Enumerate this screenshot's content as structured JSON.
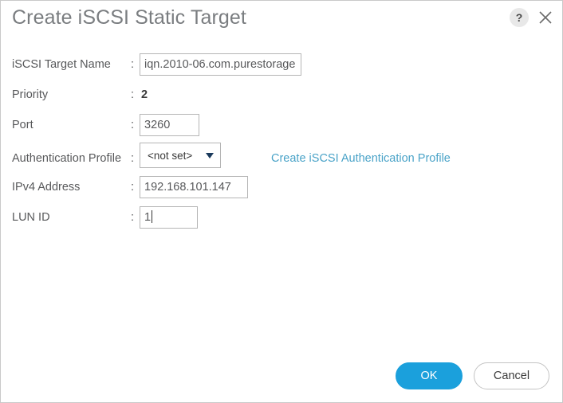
{
  "dialog": {
    "title": "Create iSCSI Static Target",
    "help_label": "?",
    "close_label": "close-icon"
  },
  "form": {
    "separator": ":",
    "fields": [
      {
        "label": "iSCSI Target Name",
        "value": "iqn.2010-06.com.purestorage",
        "type": "text"
      },
      {
        "label": "Priority",
        "value": "2",
        "type": "static"
      },
      {
        "label": "Port",
        "value": "3260",
        "type": "text"
      },
      {
        "label": "Authentication Profile",
        "value": "<not set>",
        "type": "dropdown"
      },
      {
        "label": "IPv4 Address",
        "value": "192.168.101.147",
        "type": "text"
      },
      {
        "label": "LUN ID",
        "value": "1",
        "type": "text"
      }
    ],
    "link_label": "Create iSCSI Authentication Profile"
  },
  "footer": {
    "ok_label": "OK",
    "cancel_label": "Cancel"
  },
  "colors": {
    "accent_blue": "#1ba0dc",
    "link_blue": "#4aa3c8",
    "label_gray": "#58595b",
    "title_gray": "#7a7d80",
    "border_gray": "#b5b5b5"
  }
}
